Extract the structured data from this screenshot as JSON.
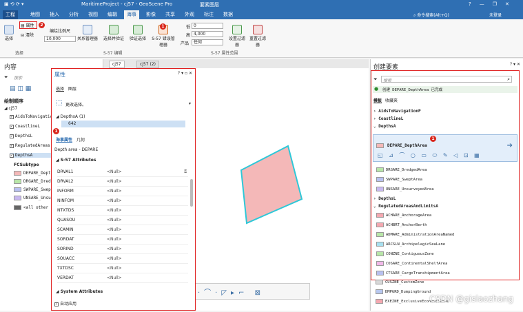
{
  "app": {
    "title": "MaritimeProject - cj57 - GeoScene Pro",
    "context_tab": "要素图层",
    "search_placeholder": "命令搜索(Alt+Q)",
    "user": "未登录",
    "window_controls": [
      "?",
      "—",
      "❐",
      "✕"
    ]
  },
  "ribbon": {
    "tabs": [
      "工程",
      "地图",
      "插入",
      "分析",
      "视图",
      "编辑",
      "海事",
      "影像",
      "共享",
      "外观",
      "标注",
      "数据"
    ],
    "active_tab": "海事",
    "select_label": "选择",
    "attributes_label": "属性",
    "clear_label": "清除",
    "scale_label": "编绘比例尺",
    "scale_value": "10,000",
    "relation_label": "关系管理器",
    "select_validate_label": "选择并验证",
    "validate_select_label": "验证选择",
    "s57_label": "S-57 错误管理器",
    "low_label": "低",
    "low_value": "0",
    "high_label": "高",
    "high_value": "4,000",
    "product_label": "产品",
    "product_value": "任何",
    "set_filter_label": "设置过滤器",
    "reset_filter_label": "重置过滤器",
    "group_select": "选择",
    "group_edit": "S-57 编辑",
    "group_filter": "S-57 属性范围",
    "badge2": "2",
    "badge1": "1"
  },
  "contents": {
    "title": "内容",
    "search_placeholder": "搜索",
    "drawing_order": "绘制顺序",
    "root": "cj57",
    "layers": [
      "AidsToNavigatio",
      "CoastlineL",
      "DepthsL",
      "RegulatedAreas",
      "DepthsA"
    ],
    "subtype_header": "FCSubtype",
    "subtypes": [
      "DEPARE_DepthA",
      "DRGARE_Dredge",
      "SWPARE_Swept",
      "UNSARE_Unsurv",
      "<all other v"
    ],
    "subtype_colors": [
      "#f4b8b8",
      "#b8e6a8",
      "#b8c0f0",
      "#c8b8f0",
      "#666666"
    ]
  },
  "map_tabs": [
    "cj57",
    "cj57 (2)"
  ],
  "attributes": {
    "title": "属性",
    "tab_select": "选择",
    "tab_layer": "图层",
    "change_selection": "更改选择。",
    "layer_name": "DepthsA (1)",
    "feature_id": "642",
    "tab_maritime": "海事属性",
    "tab_geometry": "几何",
    "class_desc": "Depth area - DEPARE",
    "s57_header": "S-57 Attributes",
    "fields": [
      {
        "name": "DRVAL1",
        "value": "<Null>"
      },
      {
        "name": "DRVAL2",
        "value": "<Null>"
      },
      {
        "name": "INFORM",
        "value": "<Null>"
      },
      {
        "name": "NINFOM",
        "value": "<Null>"
      },
      {
        "name": "NTXTDS",
        "value": "<Null>"
      },
      {
        "name": "QUASOU",
        "value": "<Null>"
      },
      {
        "name": "SCAMIN",
        "value": "<Null>"
      },
      {
        "name": "SORDAT",
        "value": "<Null>"
      },
      {
        "name": "SORIND",
        "value": "<Null>"
      },
      {
        "name": "SOUACC",
        "value": "<Null>"
      },
      {
        "name": "TXTDSC",
        "value": "<Null>"
      },
      {
        "name": "VERDAT",
        "value": "<Null>"
      }
    ],
    "system_header": "System Attributes",
    "auto_apply": "自动应用",
    "badge": "1"
  },
  "create": {
    "title": "创建要素",
    "search_placeholder": "搜索",
    "created_msg": "创建 DEPARE_DepthArea 已完成",
    "tab_templates": "模板",
    "tab_favorites": "收藏夹",
    "groups_top": [
      "AidsToNavigationP",
      "CoastlineL",
      "DepthsA"
    ],
    "selected_template": "DEPARE_DepthArea",
    "templates_a": [
      "DRGARE_DredgedArea",
      "SWPARE_SweptArea",
      "UNSARE_UnsurveyedArea"
    ],
    "template_a_colors": [
      "#b8e6a8",
      "#b8c0f0",
      "#c8b8f0"
    ],
    "group_l": "DepthsL",
    "group_reg": "RegulatedAreasAndLimitsA",
    "templates_reg": [
      "ACHARE_AnchorageArea",
      "ACHBRT_AnchorBerth",
      "ADMARE_AdministrationAreaNamed",
      "ARCSLN_ArchipelagicSeaLane",
      "CONZNE_ContiguousZone",
      "COSARE_ContinentalShelfArea",
      "CTSARE_CargoTranshipmentArea",
      "CUSZNE_CustomZone",
      "DMPGRD_DumpingGround",
      "EXEZNE_ExclusiveEconomicZone"
    ],
    "template_reg_colors": [
      "#f4a8b0",
      "#f4a8b0",
      "#b8e6a8",
      "#a8e0f0",
      "#b8e6a8",
      "#f0b8e8",
      "#b8c0f0",
      "#d8d8d8",
      "#b8c8f0",
      "#f4a8b0"
    ],
    "badge": "1"
  },
  "watermark": "CSDN @gislaozhang"
}
